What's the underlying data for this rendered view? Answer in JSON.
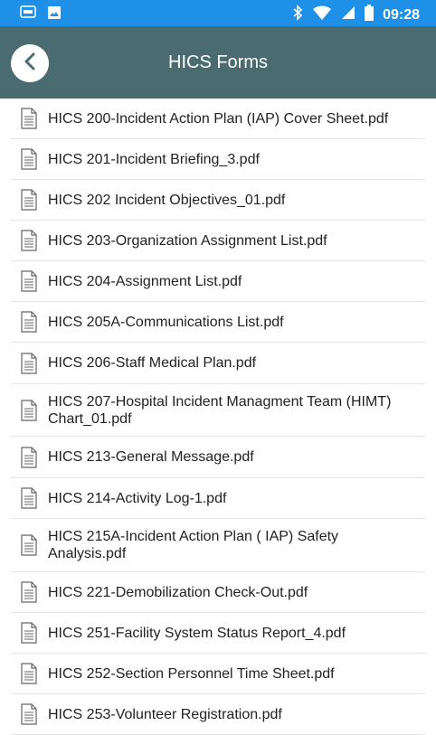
{
  "status_bar": {
    "time": "09:28",
    "left_icons": [
      "sim-icon",
      "image-icon"
    ],
    "right_icons": [
      "bluetooth-icon",
      "wifi-icon",
      "signal-icon",
      "battery-icon"
    ],
    "color": "#1e90e8"
  },
  "header": {
    "title": "HICS Forms",
    "color": "#4a6b70"
  },
  "files": [
    {
      "name": "HICS 200-Incident Action Plan (IAP) Cover Sheet.pdf"
    },
    {
      "name": "HICS 201-Incident Briefing_3.pdf"
    },
    {
      "name": "HICS 202 Incident Objectives_01.pdf"
    },
    {
      "name": "HICS 203-Organization Assignment List.pdf"
    },
    {
      "name": "HICS 204-Assignment List.pdf"
    },
    {
      "name": "HICS 205A-Communications List.pdf"
    },
    {
      "name": "HICS 206-Staff Medical Plan.pdf"
    },
    {
      "name": "HICS 207-Hospital Incident Managment Team (HIMT) Chart_01.pdf"
    },
    {
      "name": "HICS 213-General Message.pdf"
    },
    {
      "name": "HICS 214-Activity Log-1.pdf"
    },
    {
      "name": "HICS 215A-Incident Action Plan ( IAP) Safety Analysis.pdf"
    },
    {
      "name": "HICS 221-Demobilization Check-Out.pdf"
    },
    {
      "name": "HICS 251-Facility System Status Report_4.pdf"
    },
    {
      "name": "HICS 252-Section Personnel Time Sheet.pdf"
    },
    {
      "name": "HICS 253-Volunteer Registration.pdf"
    }
  ]
}
